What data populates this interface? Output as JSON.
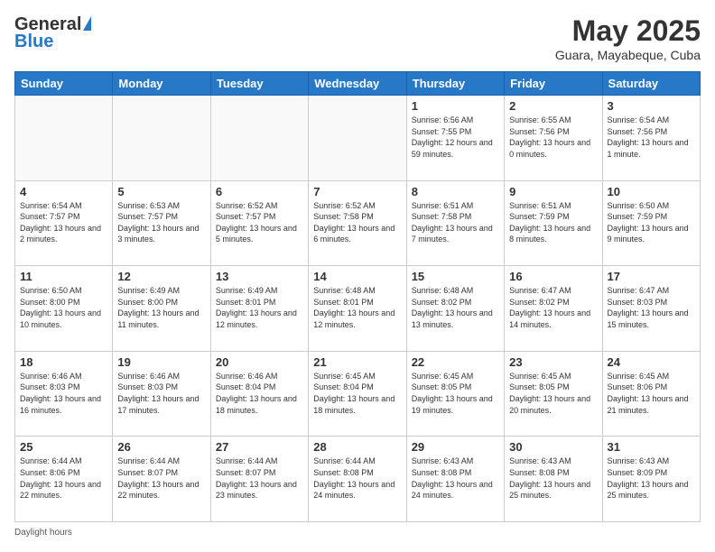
{
  "logo": {
    "general": "General",
    "blue": "Blue"
  },
  "header": {
    "month_year": "May 2025",
    "location": "Guara, Mayabeque, Cuba"
  },
  "days_of_week": [
    "Sunday",
    "Monday",
    "Tuesday",
    "Wednesday",
    "Thursday",
    "Friday",
    "Saturday"
  ],
  "weeks": [
    [
      {
        "day": "",
        "info": ""
      },
      {
        "day": "",
        "info": ""
      },
      {
        "day": "",
        "info": ""
      },
      {
        "day": "",
        "info": ""
      },
      {
        "day": "1",
        "info": "Sunrise: 6:56 AM\nSunset: 7:55 PM\nDaylight: 12 hours and 59 minutes."
      },
      {
        "day": "2",
        "info": "Sunrise: 6:55 AM\nSunset: 7:56 PM\nDaylight: 13 hours and 0 minutes."
      },
      {
        "day": "3",
        "info": "Sunrise: 6:54 AM\nSunset: 7:56 PM\nDaylight: 13 hours and 1 minute."
      }
    ],
    [
      {
        "day": "4",
        "info": "Sunrise: 6:54 AM\nSunset: 7:57 PM\nDaylight: 13 hours and 2 minutes."
      },
      {
        "day": "5",
        "info": "Sunrise: 6:53 AM\nSunset: 7:57 PM\nDaylight: 13 hours and 3 minutes."
      },
      {
        "day": "6",
        "info": "Sunrise: 6:52 AM\nSunset: 7:57 PM\nDaylight: 13 hours and 5 minutes."
      },
      {
        "day": "7",
        "info": "Sunrise: 6:52 AM\nSunset: 7:58 PM\nDaylight: 13 hours and 6 minutes."
      },
      {
        "day": "8",
        "info": "Sunrise: 6:51 AM\nSunset: 7:58 PM\nDaylight: 13 hours and 7 minutes."
      },
      {
        "day": "9",
        "info": "Sunrise: 6:51 AM\nSunset: 7:59 PM\nDaylight: 13 hours and 8 minutes."
      },
      {
        "day": "10",
        "info": "Sunrise: 6:50 AM\nSunset: 7:59 PM\nDaylight: 13 hours and 9 minutes."
      }
    ],
    [
      {
        "day": "11",
        "info": "Sunrise: 6:50 AM\nSunset: 8:00 PM\nDaylight: 13 hours and 10 minutes."
      },
      {
        "day": "12",
        "info": "Sunrise: 6:49 AM\nSunset: 8:00 PM\nDaylight: 13 hours and 11 minutes."
      },
      {
        "day": "13",
        "info": "Sunrise: 6:49 AM\nSunset: 8:01 PM\nDaylight: 13 hours and 12 minutes."
      },
      {
        "day": "14",
        "info": "Sunrise: 6:48 AM\nSunset: 8:01 PM\nDaylight: 13 hours and 12 minutes."
      },
      {
        "day": "15",
        "info": "Sunrise: 6:48 AM\nSunset: 8:02 PM\nDaylight: 13 hours and 13 minutes."
      },
      {
        "day": "16",
        "info": "Sunrise: 6:47 AM\nSunset: 8:02 PM\nDaylight: 13 hours and 14 minutes."
      },
      {
        "day": "17",
        "info": "Sunrise: 6:47 AM\nSunset: 8:03 PM\nDaylight: 13 hours and 15 minutes."
      }
    ],
    [
      {
        "day": "18",
        "info": "Sunrise: 6:46 AM\nSunset: 8:03 PM\nDaylight: 13 hours and 16 minutes."
      },
      {
        "day": "19",
        "info": "Sunrise: 6:46 AM\nSunset: 8:03 PM\nDaylight: 13 hours and 17 minutes."
      },
      {
        "day": "20",
        "info": "Sunrise: 6:46 AM\nSunset: 8:04 PM\nDaylight: 13 hours and 18 minutes."
      },
      {
        "day": "21",
        "info": "Sunrise: 6:45 AM\nSunset: 8:04 PM\nDaylight: 13 hours and 18 minutes."
      },
      {
        "day": "22",
        "info": "Sunrise: 6:45 AM\nSunset: 8:05 PM\nDaylight: 13 hours and 19 minutes."
      },
      {
        "day": "23",
        "info": "Sunrise: 6:45 AM\nSunset: 8:05 PM\nDaylight: 13 hours and 20 minutes."
      },
      {
        "day": "24",
        "info": "Sunrise: 6:45 AM\nSunset: 8:06 PM\nDaylight: 13 hours and 21 minutes."
      }
    ],
    [
      {
        "day": "25",
        "info": "Sunrise: 6:44 AM\nSunset: 8:06 PM\nDaylight: 13 hours and 22 minutes."
      },
      {
        "day": "26",
        "info": "Sunrise: 6:44 AM\nSunset: 8:07 PM\nDaylight: 13 hours and 22 minutes."
      },
      {
        "day": "27",
        "info": "Sunrise: 6:44 AM\nSunset: 8:07 PM\nDaylight: 13 hours and 23 minutes."
      },
      {
        "day": "28",
        "info": "Sunrise: 6:44 AM\nSunset: 8:08 PM\nDaylight: 13 hours and 24 minutes."
      },
      {
        "day": "29",
        "info": "Sunrise: 6:43 AM\nSunset: 8:08 PM\nDaylight: 13 hours and 24 minutes."
      },
      {
        "day": "30",
        "info": "Sunrise: 6:43 AM\nSunset: 8:08 PM\nDaylight: 13 hours and 25 minutes."
      },
      {
        "day": "31",
        "info": "Sunrise: 6:43 AM\nSunset: 8:09 PM\nDaylight: 13 hours and 25 minutes."
      }
    ]
  ],
  "footer": {
    "label": "Daylight hours"
  }
}
